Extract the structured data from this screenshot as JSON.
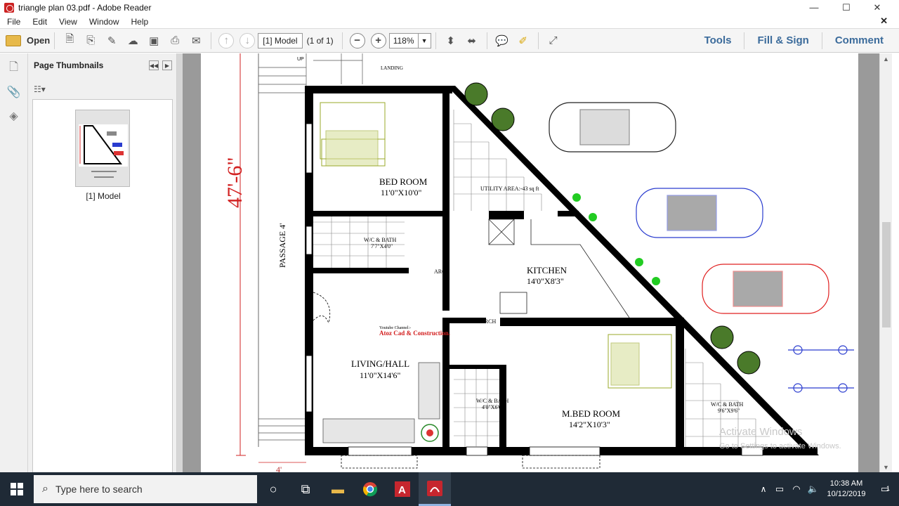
{
  "window": {
    "title": "triangle plan 03.pdf - Adobe Reader",
    "minimize": "—",
    "maximize": "☐",
    "close": "✕"
  },
  "menu": [
    "File",
    "Edit",
    "View",
    "Window",
    "Help"
  ],
  "toolbar": {
    "open_label": "Open",
    "page_field": "[1] Model",
    "page_count": "(1 of 1)",
    "zoom_value": "118%",
    "tools": "Tools",
    "fill_sign": "Fill & Sign",
    "comment": "Comment"
  },
  "sidebar": {
    "panel_title": "Page Thumbnails",
    "thumb_label": "[1] Model"
  },
  "drawing": {
    "dimension_height": "47'-6\"",
    "dimension_width": "4'",
    "passage": "PASSAGE 4'",
    "landing": "LANDING",
    "stair_up": "UP",
    "bed_room": "BED ROOM",
    "bed_room_size": "11'0\"X10'0\"",
    "wc1": "W/C & BATH",
    "wc1_size": "7'7\"X4'0\"",
    "arch": "ARCH",
    "utility": "UTILITY AREA:-43 sq ft",
    "kitchen": "KITCHEN",
    "kitchen_size": "14'0\"X8'3\"",
    "yt_label": "Youtube Channel:-",
    "channel": "Atoz Cad & Construction.",
    "living": "LIVING/HALL",
    "living_size": "11'0\"X14'6\"",
    "wc2": "W/C & BATH",
    "wc2_size": "4'0\"X6'6\"",
    "mbed": "M.BED ROOM",
    "mbed_size": "14'2\"X10'3\"",
    "wc3": "W/C & BATH",
    "wc3_size": "9'6\"X9'6\"",
    "watermark1": "Activate Windows",
    "watermark2": "Go to Settings to activate Windows."
  },
  "taskbar": {
    "search_placeholder": "Type here to search",
    "time": "10:38 AM",
    "date": "10/12/2019",
    "notification_count": "1"
  },
  "colors": {
    "title_blue": "#3b6b9b",
    "taskbar": "#1f2a36",
    "wall": "#000000",
    "dimension_red": "#d22222"
  }
}
